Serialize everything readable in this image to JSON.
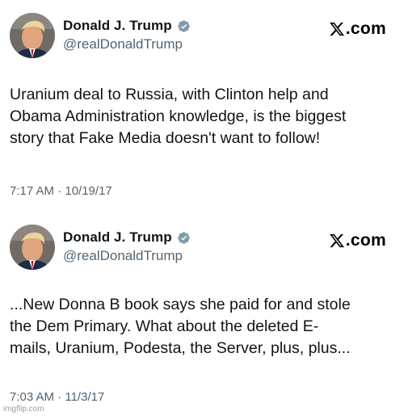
{
  "tweets": [
    {
      "author": {
        "display_name": "Donald J. Trump",
        "handle": "@realDonaldTrump",
        "verified": true,
        "verified_color": "#829aab",
        "avatar_icon": "avatar-photo"
      },
      "text_lines": [
        "Uranium deal to Russia, with Clinton help and",
        "Obama Administration knowledge, is the biggest",
        "story that Fake Media doesn't want to follow!"
      ],
      "timestamp": "7:17 AM · 10/19/17",
      "brand": "X.com"
    },
    {
      "author": {
        "display_name": "Donald J. Trump",
        "handle": "@realDonaldTrump",
        "verified": true,
        "verified_color": "#829aab",
        "avatar_icon": "avatar-photo"
      },
      "text_lines": [
        "...New Donna B book says she paid for and stole",
        "the Dem Primary. What about the deleted E-",
        "mails, Uranium, Podesta, the Server, plus, plus..."
      ],
      "timestamp": "7:03 AM · 11/3/17",
      "brand": "X.com"
    }
  ],
  "brand_text": ".com",
  "watermark": "imgflip.com"
}
